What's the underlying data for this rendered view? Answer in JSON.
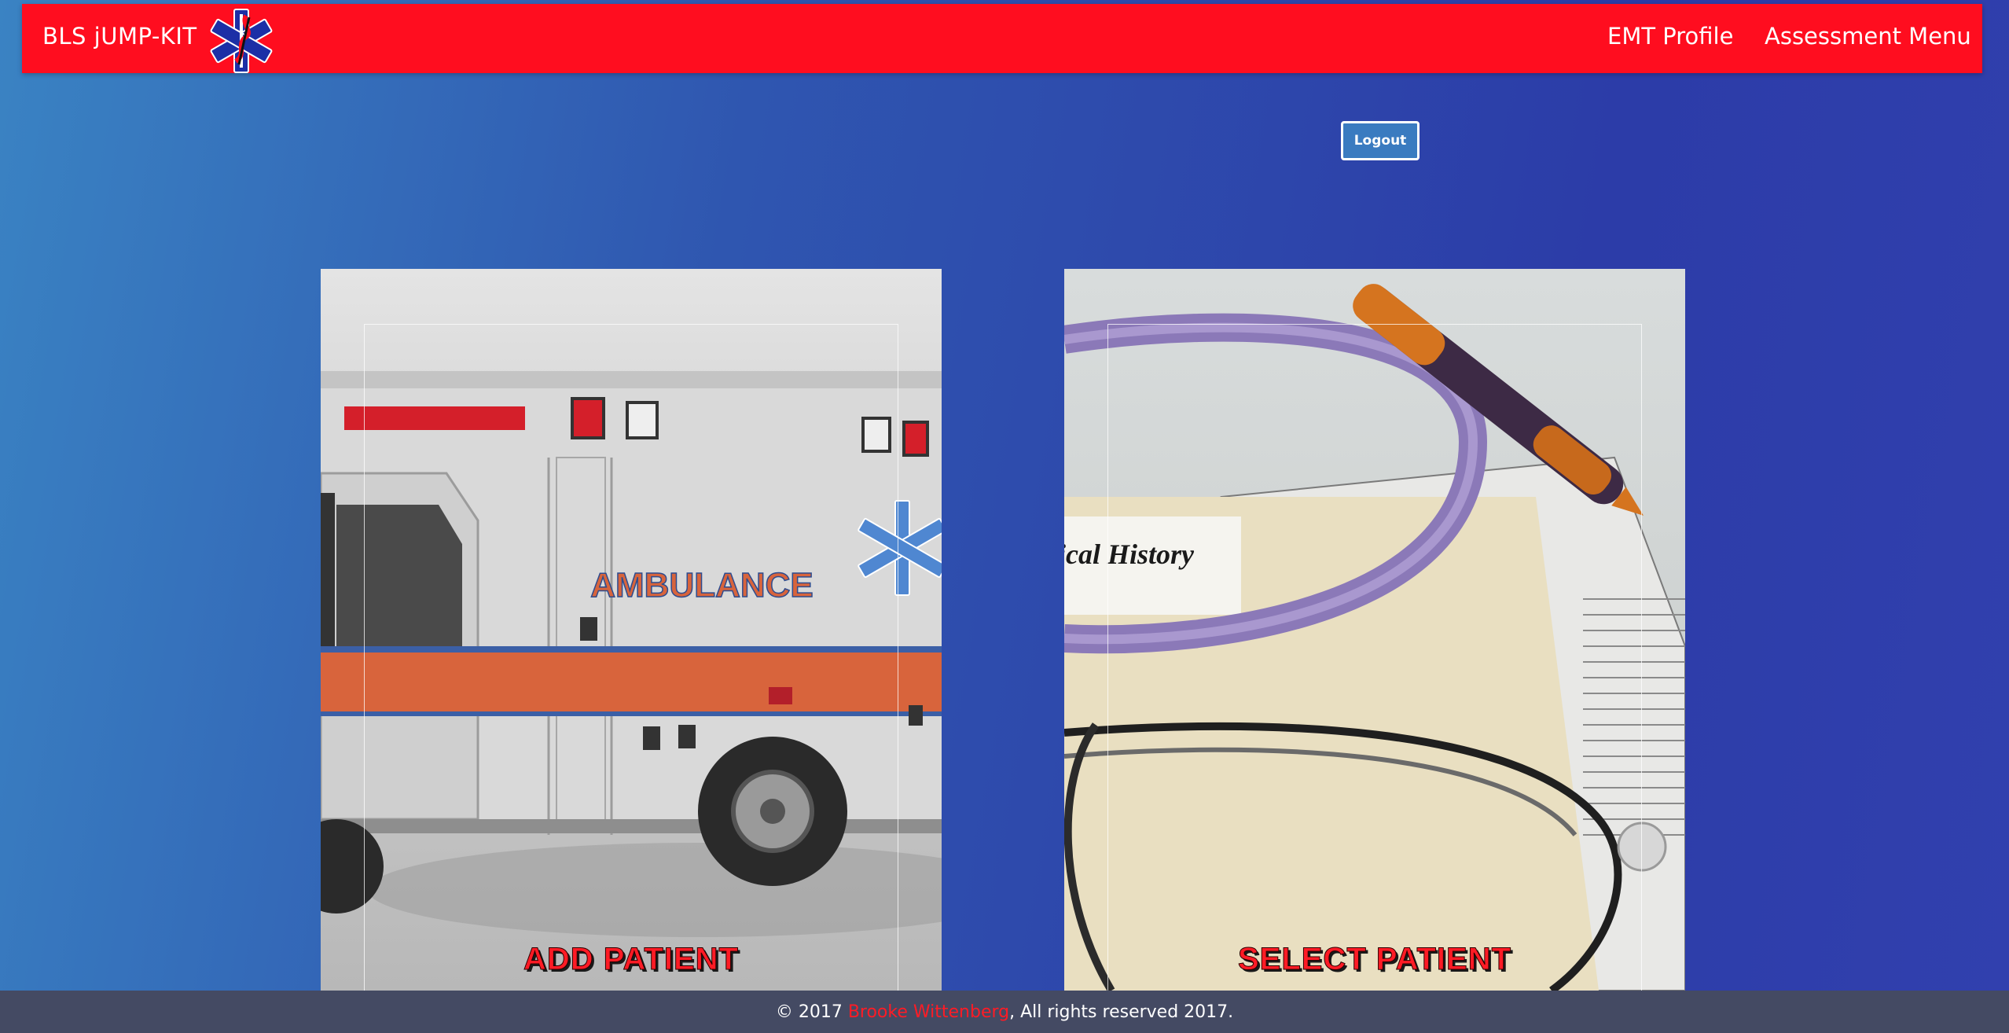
{
  "navbar": {
    "brand": "BLS jUMP-KIT",
    "logo_icon": "star-of-life-icon",
    "links": [
      "EMT Profile",
      "Assessment Menu"
    ]
  },
  "logout_label": "Logout",
  "cards": [
    {
      "label": "ADD PATIENT",
      "image": "ambulance-photo",
      "image_text": "AMBULANCE"
    },
    {
      "label": "SELECT PATIENT",
      "image": "stethoscope-medical-history-photo",
      "image_text": "ical History"
    }
  ],
  "footer": {
    "prefix": "© 2017 ",
    "author": "Brooke Wittenberg",
    "suffix": ", All rights reserved 2017."
  },
  "colors": {
    "navbar": "#ff0d1f",
    "accent_red": "#ff1b25",
    "footer": "#444a63",
    "logout_button": "#3a7bc0"
  }
}
